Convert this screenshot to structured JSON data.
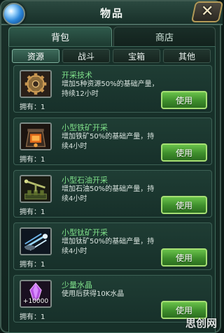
{
  "window": {
    "title": "物品",
    "close_icon": "close-icon"
  },
  "main_tabs": [
    {
      "label": "背包",
      "active": true
    },
    {
      "label": "商店",
      "active": false
    }
  ],
  "sub_tabs": [
    {
      "label": "资源",
      "active": true
    },
    {
      "label": "战斗",
      "active": false
    },
    {
      "label": "宝箱",
      "active": false
    },
    {
      "label": "其他",
      "active": false
    }
  ],
  "items": [
    {
      "name": "开采技术",
      "desc": "增加5种资源50%的基础产量，持续12小时",
      "owned": "拥有：1",
      "button": "使用",
      "icon": "gear-icon"
    },
    {
      "name": "小型铁矿开采",
      "desc": "增加铁矿50%的基础产量，持续4小时",
      "owned": "拥有：1",
      "button": "使用",
      "icon": "iron-mine-icon"
    },
    {
      "name": "小型石油开采",
      "desc": "增加石油50%的基础产量，持续4小时",
      "owned": "拥有：1",
      "button": "使用",
      "icon": "oil-pump-icon"
    },
    {
      "name": "小型钛矿开采",
      "desc": "增加钛矿50%的基础产量，持续4小时",
      "owned": "拥有：1",
      "button": "使用",
      "icon": "titanium-icon"
    },
    {
      "name": "少量水晶",
      "desc": "使用后获得10K水晶",
      "owned": "拥有：1",
      "button": "使用",
      "icon": "crystal-icon",
      "icon_label": "+10000"
    }
  ],
  "watermark": "思创网",
  "colors": {
    "item_name": "#7fe08a",
    "button": "#4fa638",
    "panel": "#173029"
  }
}
